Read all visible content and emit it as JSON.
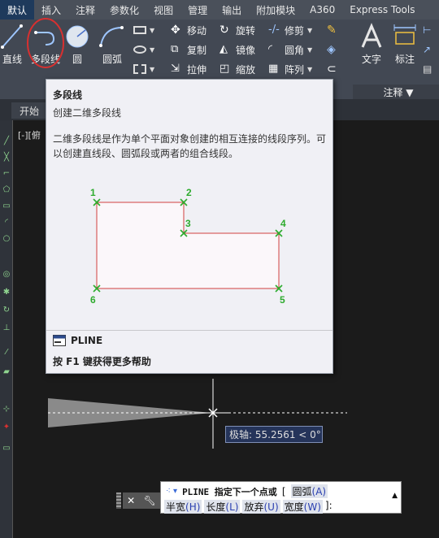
{
  "menubar": {
    "tabs": [
      "默认",
      "插入",
      "注释",
      "参数化",
      "视图",
      "管理",
      "输出",
      "附加模块",
      "A360",
      "Express Tools"
    ]
  },
  "ribbon": {
    "draw": {
      "line": "直线",
      "polyline": "多段线",
      "circle": "圆",
      "arc": "圆弧"
    },
    "modify": {
      "move": "移动",
      "rotate": "旋转",
      "trim": "修剪",
      "copy": "复制",
      "mirror": "镜像",
      "fillet": "圆角",
      "stretch": "拉伸",
      "scale": "缩放",
      "array": "阵列"
    },
    "annotation": {
      "text": "文字",
      "dimension": "标注",
      "panel_title": "注释 ▼"
    }
  },
  "file_tabs": {
    "start": "开始"
  },
  "viewport": {
    "label": "[-][俯"
  },
  "tooltip": {
    "title": "多段线",
    "subtitle": "创建二维多段线",
    "description": "二维多段线是作为单个平面对象创建的相互连接的线段序列。可以创建直线段、圆弧段或两者的组合线段。",
    "points": [
      "1",
      "2",
      "3",
      "4",
      "5",
      "6"
    ],
    "command": "PLINE",
    "help": "按 F1 键获得更多帮助"
  },
  "polar_tooltip": {
    "text": "极轴: 55.2561 < 0°"
  },
  "command_line": {
    "prompt": "PLINE 指定下一个点或",
    "open_bracket": "[",
    "options": [
      {
        "label": "圆弧",
        "key": "(A)"
      },
      {
        "label": "半宽",
        "key": "(H)"
      },
      {
        "label": "长度",
        "key": "(L)"
      },
      {
        "label": "放弃",
        "key": "(U)"
      },
      {
        "label": "宽度",
        "key": "(W)"
      }
    ],
    "close": "]:"
  },
  "colors": {
    "accent_tab": "#1e3a5c",
    "diagram_marker": "#2eab2e",
    "diagram_line": "#d24040",
    "polyline_highlight": "#d83030"
  }
}
